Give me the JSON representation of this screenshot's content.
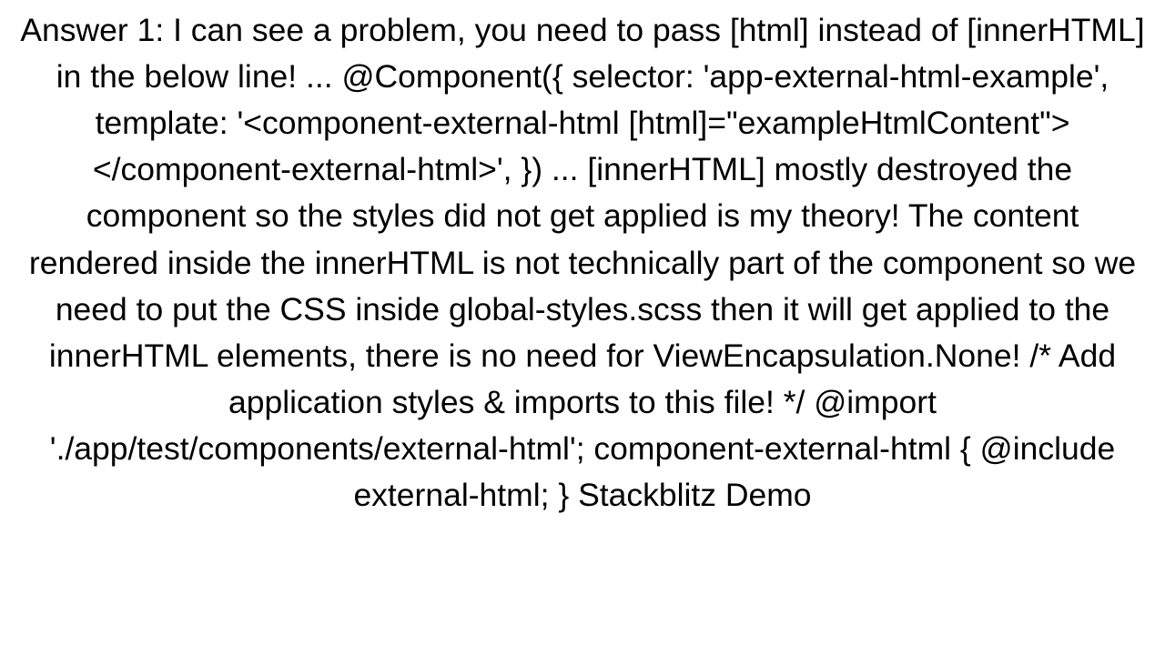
{
  "answer": {
    "text": "Answer 1: I can see a problem, you need to pass [html] instead of [innerHTML] in the below line! ... @Component({   selector: 'app-external-html-example',   template:    '<component-external-html [html]=\"exampleHtmlContent\"></component-external-html>', }) ...  [innerHTML] mostly destroyed the component so the styles did not get applied is my theory!  The content rendered inside the innerHTML is not technically part of the component so we need to put the CSS inside global-styles.scss then it will get applied to the innerHTML elements, there is no need for ViewEncapsulation.None! /* Add application styles & imports to this file! */  @import './app/test/components/external-html';  component-external-html {   @include external-html; }  Stackblitz Demo"
  }
}
